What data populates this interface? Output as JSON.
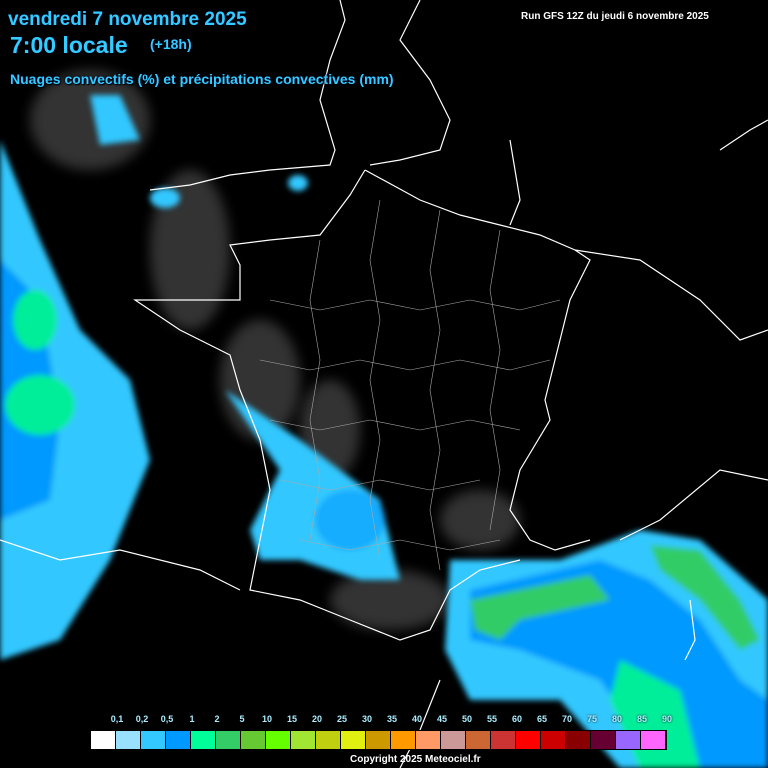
{
  "header": {
    "date": "vendredi 7 novembre 2025",
    "time": "7:00 locale",
    "lead": "(+18h)",
    "subtitle": "Nuages convectifs (%) et précipitations convectives (mm)",
    "run": "Run GFS 12Z du jeudi 6 novembre 2025"
  },
  "legend": {
    "labels": [
      "0,1",
      "0,2",
      "0,5",
      "1",
      "2",
      "5",
      "10",
      "15",
      "20",
      "25",
      "30",
      "35",
      "40",
      "45",
      "50",
      "55",
      "60",
      "65",
      "70",
      "75",
      "80",
      "85",
      "90"
    ],
    "colors": [
      "#ffffff",
      "#99e0ff",
      "#33c8ff",
      "#0099ff",
      "#00ff99",
      "#33cc66",
      "#66c833",
      "#66ff00",
      "#a0e632",
      "#c0d010",
      "#e0f010",
      "#cc9900",
      "#ff9900",
      "#ff9966",
      "#cc9999",
      "#cc6633",
      "#cc3333",
      "#ff0000",
      "#cc0000",
      "#880000",
      "#660033",
      "#9966ff",
      "#ff66ff"
    ]
  },
  "footer": {
    "copyright": "Copyright 2025 Meteociel.fr"
  }
}
